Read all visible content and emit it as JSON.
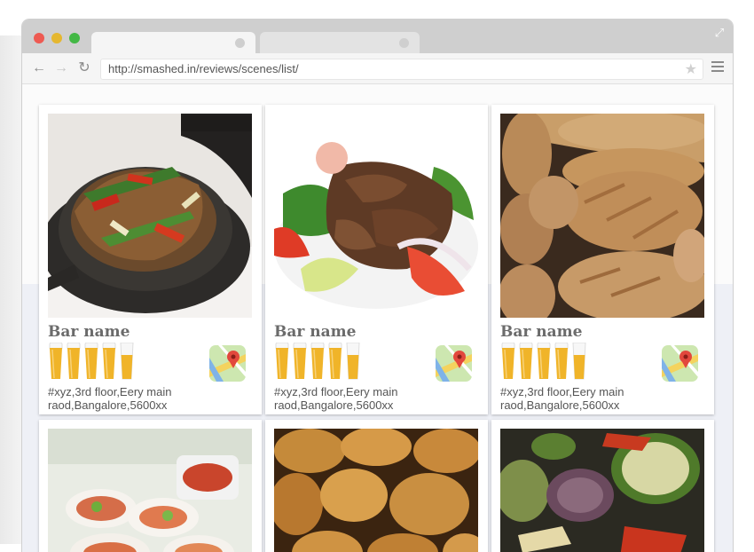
{
  "browser": {
    "url": "http://smashed.in/reviews/scenes/list/"
  },
  "cards": [
    {
      "name": "Bar name",
      "address_line1": "#xyz,3rd floor,Eery main",
      "address_line2": "raod,Bangalore,5600xx",
      "rating": 5
    },
    {
      "name": "Bar name",
      "address_line1": "#xyz,3rd floor,Eery main",
      "address_line2": "raod,Bangalore,5600xx",
      "rating": 5
    },
    {
      "name": "Bar name",
      "address_line1": "#xyz,3rd floor,Eery main",
      "address_line2": "raod,Bangalore,5600xx",
      "rating": 5
    }
  ],
  "colors": {
    "titlebar": "#cfcfcf",
    "beer": "#f0b429",
    "text": "#555555"
  }
}
